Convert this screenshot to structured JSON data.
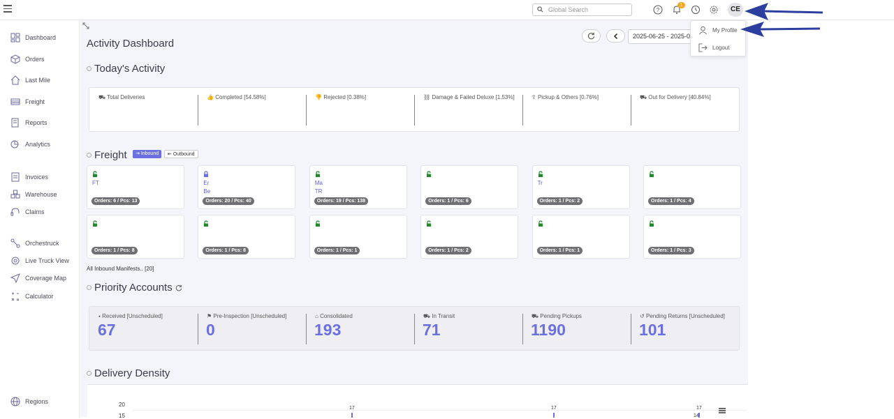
{
  "topbar": {
    "search_placeholder": "Global Search",
    "notification_count": "1",
    "avatar_initials": "CE"
  },
  "profile_menu": {
    "my_profile": "My Profile",
    "logout": "Logout"
  },
  "sidebar": {
    "items": [
      {
        "label": "Dashboard",
        "icon": "dashboard-icon"
      },
      {
        "label": "Orders",
        "icon": "box-icon"
      },
      {
        "label": "Last Mile",
        "icon": "house-icon"
      },
      {
        "label": "Freight",
        "icon": "truck-icon"
      },
      {
        "label": "Reports",
        "icon": "report-icon"
      },
      {
        "label": "Analytics",
        "icon": "analytics-icon"
      },
      {
        "label": "Invoices",
        "icon": "invoice-icon"
      },
      {
        "label": "Warehouse",
        "icon": "warehouse-icon"
      },
      {
        "label": "Claims",
        "icon": "headset-icon"
      },
      {
        "label": "Orchestruck",
        "icon": "route-icon"
      },
      {
        "label": "Live Truck View",
        "icon": "target-icon"
      },
      {
        "label": "Coverage Map",
        "icon": "send-icon"
      },
      {
        "label": "Calculator",
        "icon": "calculator-icon"
      },
      {
        "label": "Regions",
        "icon": "globe-icon"
      }
    ]
  },
  "header": {
    "title": "Activity Dashboard",
    "date_range": "2025-06-25 - 2025-0"
  },
  "todays_activity": {
    "title": "Today's Activity",
    "stats": [
      {
        "label": "Total Deliveries"
      },
      {
        "label": "Completed [54.58%]"
      },
      {
        "label": "Rejected [0.38%]"
      },
      {
        "label": "Damage & Failed Deluxe [1.53%]"
      },
      {
        "label": "Pickup & Others [0.76%]"
      },
      {
        "label": "Out for Delivery [40.84%]"
      }
    ]
  },
  "freight": {
    "title": "Freight",
    "inbound_label": "Inbound",
    "outbound_label": "Outbound",
    "cards": [
      {
        "line1": "FT",
        "line2": "",
        "pill": "Orders: 6 / Pcs: 13",
        "locked": false
      },
      {
        "line1": "Er",
        "line2": "Be",
        "pill": "Orders: 20 / Pcs: 40",
        "locked": true
      },
      {
        "line1": "Ma",
        "line2": "TR",
        "pill": "Orders: 19 / Pcs: 138",
        "locked": false
      },
      {
        "line1": "",
        "line2": "",
        "pill": "Orders: 1 / Pcs: 6",
        "locked": false
      },
      {
        "line1": "Tr",
        "line2": "",
        "pill": "Orders: 1 / Pcs: 2",
        "locked": false
      },
      {
        "line1": "",
        "line2": "",
        "pill": "Orders: 1 / Pcs: 4",
        "locked": false
      },
      {
        "line1": "",
        "line2": "",
        "pill": "Orders: 1 / Pcs: 8",
        "locked": false
      },
      {
        "line1": "",
        "line2": "",
        "pill": "Orders: 1 / Pcs: 8",
        "locked": false
      },
      {
        "line1": "",
        "line2": "",
        "pill": "Orders: 1 / Pcs: 1",
        "locked": false
      },
      {
        "line1": "",
        "line2": "",
        "pill": "Orders: 1 / Pcs: 2",
        "locked": false
      },
      {
        "line1": "",
        "line2": "",
        "pill": "Orders: 1 / Pcs: 1",
        "locked": false
      },
      {
        "line1": "",
        "line2": "",
        "pill": "Orders: 1 / Pcs: 3",
        "locked": false
      }
    ],
    "all_manifests": "All Inbound Manifests.. [20]"
  },
  "priority_accounts": {
    "title": "Priority Accounts",
    "stats": [
      {
        "label": "Received [Unscheduled]",
        "value": "67"
      },
      {
        "label": "Pre-Inspection [Unscheduled]",
        "value": "0"
      },
      {
        "label": "Consolidated",
        "value": "193"
      },
      {
        "label": "In Transit",
        "value": "71"
      },
      {
        "label": "Pending Pickups",
        "value": "1190"
      },
      {
        "label": "Pending Returns [Unscheduled]",
        "value": "101"
      }
    ]
  },
  "delivery_density": {
    "title": "Delivery Density",
    "y_tick_top": "20",
    "y_tick_next": "15",
    "point_labels": [
      "17",
      "17",
      "17",
      "14"
    ]
  },
  "colors": {
    "accent": "#6b6fe0",
    "badge": "#f5a623",
    "annotation_arrow": "#2c3e9e"
  }
}
